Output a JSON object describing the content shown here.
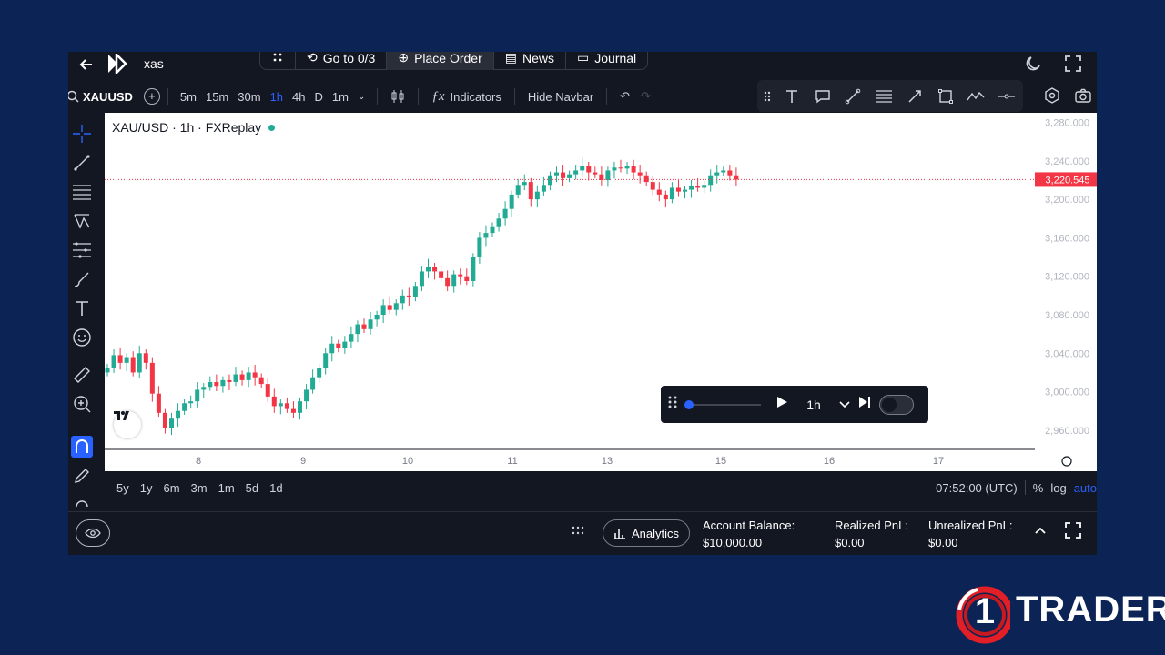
{
  "topbar": {
    "workspace_name": "xas",
    "nav": [
      {
        "label": "Go to 0/3",
        "icon": "refresh-icon"
      },
      {
        "label": "Place Order",
        "icon": "plus-circle-icon"
      },
      {
        "label": "News",
        "icon": "news-icon"
      },
      {
        "label": "Journal",
        "icon": "calendar-icon"
      }
    ]
  },
  "toolbar": {
    "symbol": "XAUUSD",
    "timeframes": [
      "5m",
      "15m",
      "30m",
      "1h",
      "4h",
      "D",
      "1m"
    ],
    "active_timeframe": "1h",
    "indicators_label": "Indicators",
    "hide_navbar_label": "Hide Navbar"
  },
  "chart": {
    "legend": "XAU/USD · 1h · FXReplay",
    "price_label": "3,220.545",
    "y_ticks": [
      "3,280.000",
      "3,240.000",
      "3,200.000",
      "3,160.000",
      "3,120.000",
      "3,080.000",
      "3,040.000",
      "3,000.000",
      "2,960.000"
    ],
    "x_ticks": [
      "8",
      "9",
      "10",
      "11",
      "13",
      "15",
      "16",
      "17"
    ],
    "tv_badge": "TV"
  },
  "chart_data": {
    "type": "candlestick",
    "symbol": "XAU/USD",
    "interval": "1h",
    "ylim": [
      2940,
      3290
    ],
    "last_price": 3220.545,
    "y_ticks": [
      3280,
      3240,
      3200,
      3160,
      3120,
      3080,
      3040,
      3000,
      2960
    ],
    "x_ticks": [
      "8",
      "9",
      "10",
      "11",
      "13",
      "15",
      "16",
      "17"
    ],
    "close_path": [
      3025,
      3038,
      3030,
      3036,
      3020,
      3040,
      3030,
      2998,
      2978,
      2962,
      2972,
      2980,
      2988,
      2990,
      3002,
      3005,
      3010,
      3006,
      3012,
      3010,
      3018,
      3012,
      3020,
      3015,
      3008,
      2995,
      2985,
      2988,
      2982,
      2978,
      2990,
      3002,
      3015,
      3025,
      3040,
      3050,
      3045,
      3052,
      3060,
      3070,
      3065,
      3075,
      3080,
      3090,
      3085,
      3092,
      3100,
      3098,
      3110,
      3125,
      3130,
      3125,
      3118,
      3110,
      3122,
      3120,
      3115,
      3140,
      3160,
      3165,
      3172,
      3180,
      3190,
      3205,
      3215,
      3218,
      3200,
      3208,
      3215,
      3225,
      3228,
      3222,
      3226,
      3230,
      3235,
      3228,
      3226,
      3220,
      3230,
      3233,
      3232,
      3235,
      3228,
      3225,
      3218,
      3210,
      3205,
      3200,
      3212,
      3208,
      3210,
      3214,
      3212,
      3215,
      3225,
      3228,
      3230,
      3225,
      3220.5
    ]
  },
  "replay": {
    "speed": "1h",
    "progress": 0
  },
  "range_bar": {
    "ranges": [
      "5y",
      "1y",
      "6m",
      "3m",
      "1m",
      "5d",
      "1d"
    ],
    "time": "07:52:00 (UTC)",
    "percent": "%",
    "log": "log",
    "auto": "auto"
  },
  "bottom": {
    "analytics_label": "Analytics",
    "account_balance_label": "Account Balance:",
    "account_balance_value": "$10,000.00",
    "realized_label": "Realized PnL:",
    "realized_value": "$0.00",
    "unrealized_label": "Unrealized PnL:",
    "unrealized_value": "$0.00"
  },
  "brand": {
    "number": "1",
    "text": "TRADER"
  },
  "colors": {
    "background": "#0b2455",
    "app": "#131722",
    "up": "#22ab94",
    "down": "#f23645",
    "accent": "#2962ff"
  }
}
